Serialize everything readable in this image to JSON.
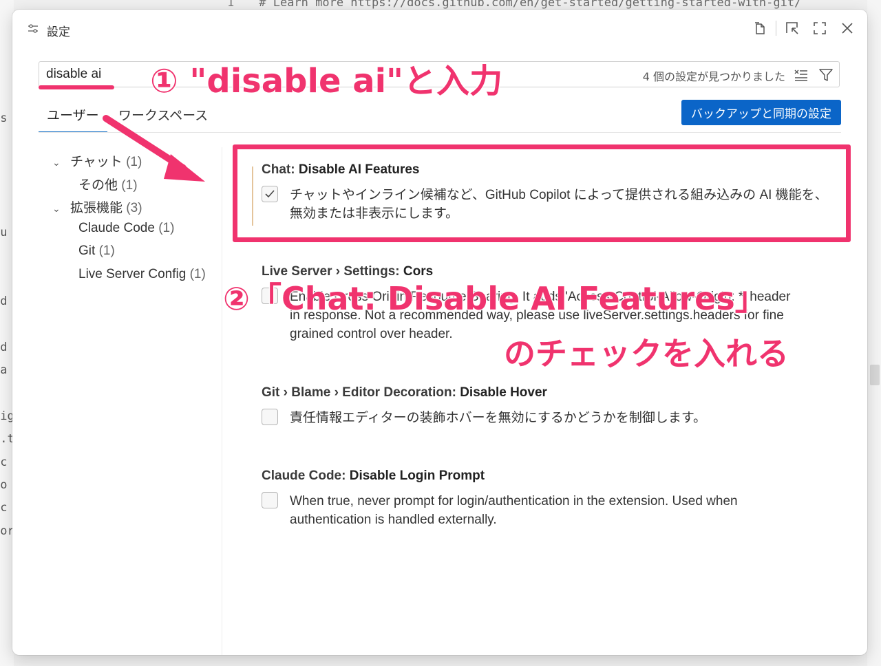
{
  "background": {
    "line_number": "1",
    "code_line": "# Learn more https://docs.github.com/en/get-started/getting-started-with-git/"
  },
  "dialog": {
    "title": "設定"
  },
  "search": {
    "value": "disable ai",
    "result_count": "4 個の設定が見つかりました"
  },
  "tabs": [
    {
      "label": "ユーザー",
      "active": true
    },
    {
      "label": "ワークスペース",
      "active": false
    }
  ],
  "backup_button": "バックアップと同期の設定",
  "tree": [
    {
      "label": "チャット",
      "count": "(1)",
      "expanded": true
    },
    {
      "label": "その他",
      "count": "(1)"
    },
    {
      "label": "拡張機能",
      "count": "(3)",
      "expanded": true
    },
    {
      "label": "Claude Code",
      "count": "(1)"
    },
    {
      "label": "Git",
      "count": "(1)"
    },
    {
      "label": "Live Server Config",
      "count": "(1)"
    }
  ],
  "settings": [
    {
      "category": "Chat: ",
      "name": "Disable AI Features",
      "checked": true,
      "description": "チャットやインライン候補など、GitHub Copilot によって提供される組み込みの AI 機能を、無効または非表示にします。"
    },
    {
      "category": "Live Server › Settings: ",
      "name": "Cors",
      "checked": false,
      "description": "Enable Cross Origin Resource Sharing. It adds 'Access-Control-Allow-Origin: *' header in response. Not a recommended way, please use liveServer.settings.headers for fine grained control over header."
    },
    {
      "category": "Git › Blame › Editor Decoration: ",
      "name": "Disable Hover",
      "checked": false,
      "description": "責任情報エディターの装飾ホバーを無効にするかどうかを制御します。"
    },
    {
      "category": "Claude Code: ",
      "name": "Disable Login Prompt",
      "checked": false,
      "description": "When true, never prompt for login/authentication in the extension. Used when authentication is handled externally."
    }
  ],
  "annotations": {
    "step1": "① \"disable ai\"と入力",
    "step2_line1": "②「Chat: Disable AI Features」",
    "step2_line2": "のチェックを入れる"
  },
  "colors": {
    "annotation": "#f0336e",
    "primary_button": "#0b65c8",
    "tab_active": "#1a73c8"
  }
}
